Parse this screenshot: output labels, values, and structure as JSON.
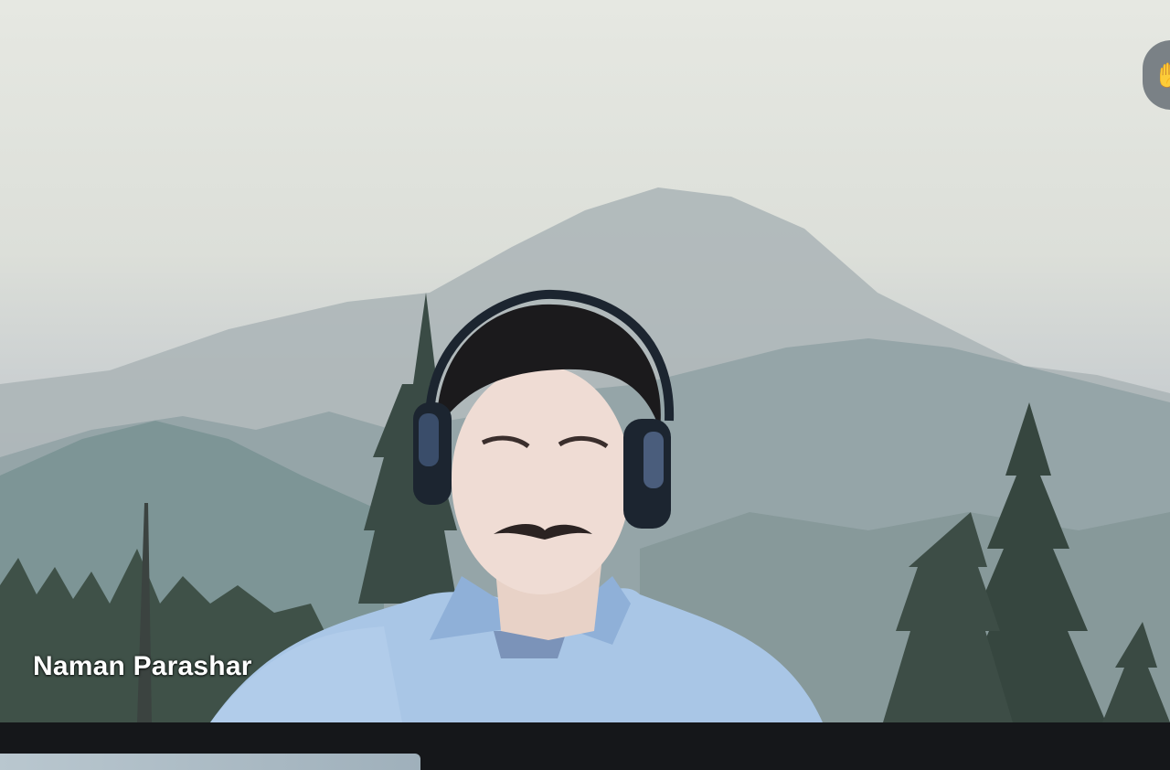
{
  "participant": {
    "name": "Naman Parashar"
  },
  "controls": {
    "self_view_icon": "hand-raise-icon",
    "self_view_glyph": "✋"
  },
  "colors": {
    "shirt": "#a9c6e6",
    "headphones": "#1c2530",
    "hair": "#1b1a1c",
    "tree": "#33433d",
    "mountain_far": "#a2aeb2",
    "mountain_near": "#7f9597"
  }
}
